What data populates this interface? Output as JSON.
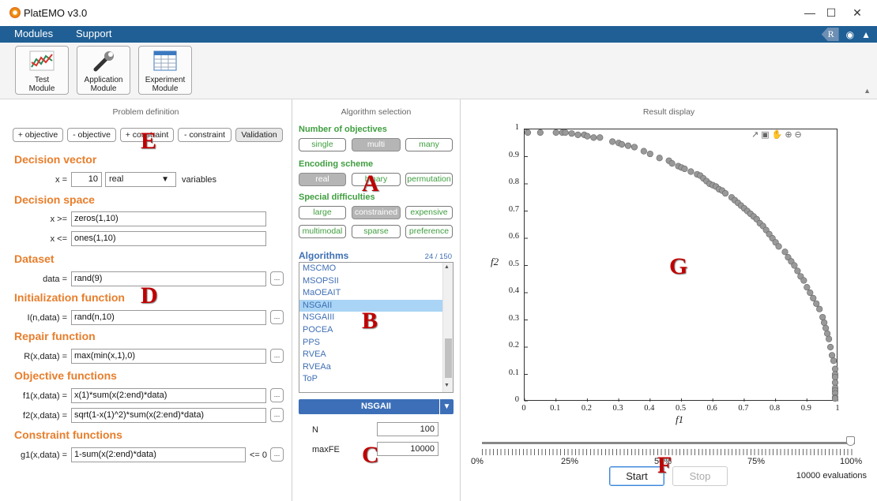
{
  "window": {
    "title": "PlatEMO v3.0"
  },
  "menu": {
    "items": [
      "Modules",
      "Support"
    ],
    "right_badge": "R"
  },
  "toolbar": {
    "buttons": [
      {
        "label1": "Test",
        "label2": "Module"
      },
      {
        "label1": "Application",
        "label2": "Module"
      },
      {
        "label1": "Experiment",
        "label2": "Module"
      }
    ]
  },
  "problem": {
    "title": "Problem definition",
    "buttons": [
      "+ objective",
      "- objective",
      "+ constraint",
      "- constraint",
      "Validation"
    ],
    "decision_vector": {
      "heading": "Decision vector",
      "x_label": "x =",
      "x_value": "10",
      "type_value": "real",
      "suffix": "variables"
    },
    "decision_space": {
      "heading": "Decision space",
      "lower_label": "x >=",
      "lower_value": "zeros(1,10)",
      "upper_label": "x <=",
      "upper_value": "ones(1,10)"
    },
    "dataset": {
      "heading": "Dataset",
      "label": "data =",
      "value": "rand(9)"
    },
    "init": {
      "heading": "Initialization function",
      "label": "I(n,data) =",
      "value": "rand(n,10)"
    },
    "repair": {
      "heading": "Repair function",
      "label": "R(x,data) =",
      "value": "max(min(x,1),0)"
    },
    "objectives": {
      "heading": "Objective functions",
      "f1_label": "f1(x,data) =",
      "f1_value": "x(1)*sum(x(2:end)*data)",
      "f2_label": "f2(x,data) =",
      "f2_value": "sqrt(1-x(1)^2)*sum(x(2:end)*data)"
    },
    "constraints": {
      "heading": "Constraint functions",
      "g1_label": "g1(x,data) =",
      "g1_value": "1-sum(x(2:end)*data)",
      "g1_suffix": "<= 0"
    },
    "dots": "..."
  },
  "algorithm": {
    "title": "Algorithm selection",
    "num_obj_heading": "Number of objectives",
    "num_obj": [
      "single",
      "multi",
      "many"
    ],
    "encoding_heading": "Encoding scheme",
    "encoding": [
      "real",
      "binary",
      "permutation"
    ],
    "special_heading": "Special difficulties",
    "special": [
      "large",
      "constrained",
      "expensive",
      "multimodal",
      "sparse",
      "preference"
    ],
    "algorithms_heading": "Algorithms",
    "count": "24 / 150",
    "list": [
      "MSCMO",
      "MSOPSII",
      "MaOEAIT",
      "NSGAII",
      "NSGAIII",
      "POCEA",
      "PPS",
      "RVEA",
      "RVEAa",
      "ToP"
    ],
    "selected": "NSGAII",
    "params": {
      "n_label": "N",
      "n_value": "100",
      "maxfe_label": "maxFE",
      "maxfe_value": "10000"
    }
  },
  "result": {
    "title": "Result display",
    "slider_labels": [
      "0%",
      "25%",
      "50%",
      "75%",
      "100%"
    ],
    "progress": 1.0,
    "start": "Start",
    "stop": "Stop",
    "evaluations": "10000 evaluations"
  },
  "annotations": [
    "A",
    "B",
    "C",
    "D",
    "E",
    "F",
    "G"
  ],
  "chart_data": {
    "type": "scatter",
    "xlabel": "f1",
    "ylabel": "f2",
    "xlim": [
      0,
      1
    ],
    "ylim": [
      0,
      1
    ],
    "xticks": [
      "0",
      "0.1",
      "0.2",
      "0.3",
      "0.4",
      "0.5",
      "0.6",
      "0.7",
      "0.8",
      "0.9",
      "1"
    ],
    "yticks": [
      "0",
      "0.1",
      "0.2",
      "0.3",
      "0.4",
      "0.5",
      "0.6",
      "0.7",
      "0.8",
      "0.9",
      "1"
    ],
    "marker_color": "#999999",
    "x": [
      0.0,
      0.05,
      0.1,
      0.12,
      0.13,
      0.15,
      0.17,
      0.19,
      0.2,
      0.22,
      0.24,
      0.28,
      0.3,
      0.31,
      0.33,
      0.35,
      0.38,
      0.4,
      0.43,
      0.46,
      0.47,
      0.49,
      0.5,
      0.51,
      0.53,
      0.55,
      0.56,
      0.57,
      0.58,
      0.59,
      0.6,
      0.61,
      0.62,
      0.63,
      0.64,
      0.66,
      0.67,
      0.68,
      0.69,
      0.7,
      0.71,
      0.72,
      0.73,
      0.74,
      0.75,
      0.76,
      0.77,
      0.78,
      0.79,
      0.8,
      0.81,
      0.83,
      0.84,
      0.85,
      0.86,
      0.87,
      0.88,
      0.89,
      0.9,
      0.91,
      0.92,
      0.93,
      0.94,
      0.95,
      0.955,
      0.96,
      0.965,
      0.97,
      0.975,
      0.98,
      0.985,
      0.99,
      0.99,
      0.995,
      0.995,
      1.0,
      1.0,
      1.0,
      1.0,
      1.0
    ],
    "y": [
      1.0,
      1.0,
      0.995,
      0.99,
      0.99,
      0.985,
      0.98,
      0.98,
      0.975,
      0.97,
      0.97,
      0.955,
      0.95,
      0.945,
      0.94,
      0.935,
      0.92,
      0.91,
      0.895,
      0.885,
      0.875,
      0.865,
      0.86,
      0.855,
      0.845,
      0.835,
      0.83,
      0.82,
      0.81,
      0.8,
      0.795,
      0.79,
      0.78,
      0.775,
      0.765,
      0.75,
      0.74,
      0.73,
      0.72,
      0.71,
      0.7,
      0.69,
      0.68,
      0.67,
      0.655,
      0.645,
      0.63,
      0.615,
      0.6,
      0.585,
      0.57,
      0.55,
      0.53,
      0.515,
      0.5,
      0.48,
      0.46,
      0.445,
      0.42,
      0.4,
      0.38,
      0.36,
      0.34,
      0.31,
      0.29,
      0.27,
      0.25,
      0.23,
      0.2,
      0.17,
      0.15,
      0.12,
      0.1,
      0.09,
      0.07,
      0.05,
      0.04,
      0.03,
      0.015,
      0.0
    ]
  }
}
